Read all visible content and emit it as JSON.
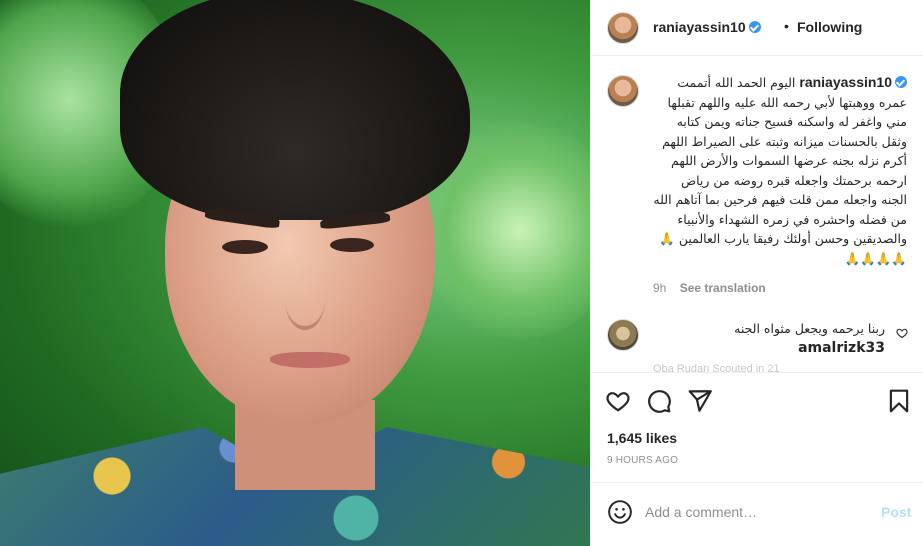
{
  "post": {
    "username": "raniayassin10",
    "follow_status": "Following",
    "separator": "•",
    "caption": "اليوم الحمد الله أتممت عمره ووهبتها لأبي رحمه الله عليه واللهم تقبلها مني واغفر له واسكنه فسيح جناته ويمن كتابه وثقل بالحسنات ميزانه وثبته على الصيراط اللهم أكرم نزله بجنه عرضها السموات والأرض اللهم ارحمه برحمتك واجعله قبره روضه من رياض الجنه واجعله ممن قلت فيهم فرحين بما آتاهم الله من فضله واحشره في زمره الشهداء والأنبياء والصديقين وحسن أولئك رفيقا يارب العالمين 🙏🙏🙏🙏🙏",
    "caption_time": "9h",
    "see_translation": "See translation",
    "likes": "1,645 likes",
    "timestamp": "9 HOURS AGO"
  },
  "comment": {
    "username": "amalrizk33",
    "text": "ربنا يرحمه ويجعل مثواه الجنه",
    "faded_line": "Oba Rudan Scouted in 21"
  },
  "add_comment": {
    "placeholder": "Add a comment…",
    "post_label": "Post"
  },
  "icons": {
    "like": "heart-icon",
    "comment": "comment-icon",
    "share": "paper-plane-icon",
    "save": "bookmark-icon",
    "emoji": "smiley-icon",
    "verified": "verified-badge-icon"
  },
  "colors": {
    "verified": "#3897f0",
    "post_button_disabled": "#b2dffc",
    "muted_text": "#8e8e8e"
  }
}
